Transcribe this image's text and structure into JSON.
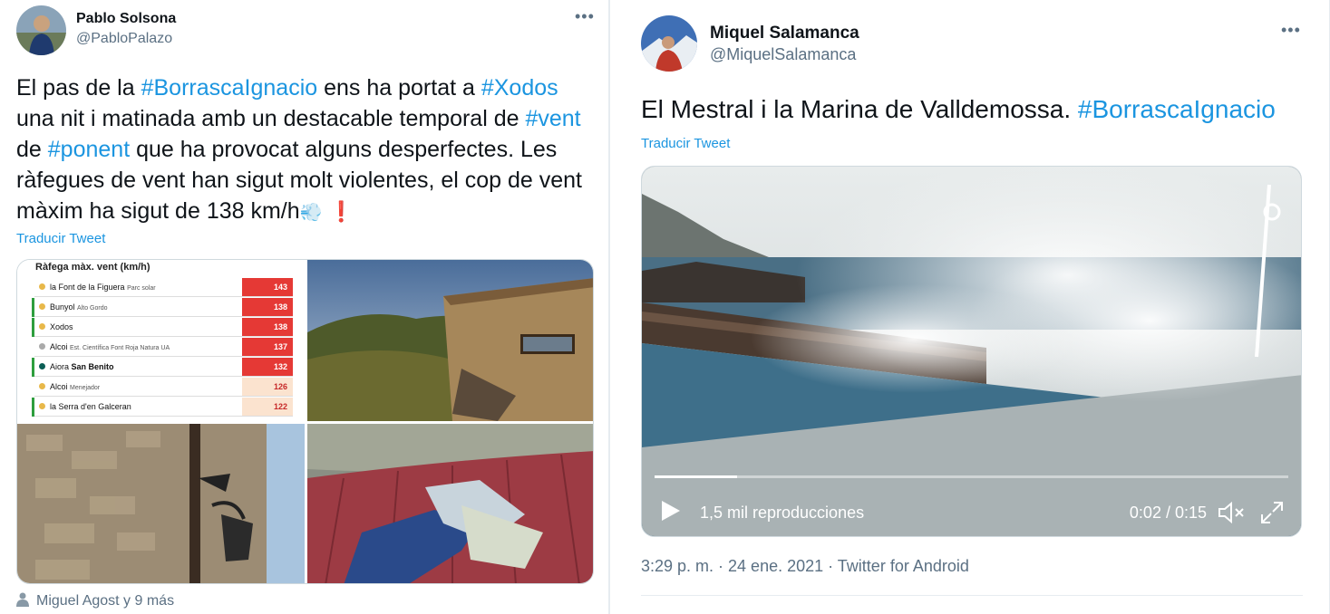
{
  "left_tweet": {
    "author_name": "Pablo Solsona",
    "handle": "@PabloPalazo",
    "more_label": "•••",
    "text_parts": {
      "p1": "El pas de la ",
      "h1": "#BorrascaIgnacio",
      "p2": " ens ha portat a ",
      "h2": "#Xodos",
      "p3": " una nit i matinada amb un destacable temporal de ",
      "h3": "#vent",
      "p4": " de ",
      "h4": "#ponent",
      "p5": " que ha provocat alguns desperfectes. Les ràfegues de vent han sigut molt violentes, el cop de vent màxim ha sigut de 138 km/h",
      "emoji_wind": "💨",
      "emoji_exclaim": "❗"
    },
    "translate_label": "Traducir Tweet",
    "wind_table": {
      "title": "Ràfega màx. vent (km/h)",
      "rows": [
        {
          "place": "la Font de la Figuera",
          "detail": "Parc solar",
          "value": "143",
          "dot": "#e8b84a",
          "bar": "#ffffff",
          "valcolor": "#e53935"
        },
        {
          "place": "Bunyol",
          "detail": "Alto Gordo",
          "value": "138",
          "dot": "#e8b84a",
          "bar": "#2e9e3e",
          "valcolor": "#e53935"
        },
        {
          "place": "Xodos",
          "detail": "",
          "value": "138",
          "dot": "#e8b84a",
          "bar": "#2e9e3e",
          "valcolor": "#e53935"
        },
        {
          "place": "Alcoi",
          "detail": "Est. Científica Font Roja Natura UA",
          "value": "137",
          "dot": "#aaaaaa",
          "bar": "#ffffff",
          "valcolor": "#e53935"
        },
        {
          "place": "Aiora",
          "detail": "San Benito",
          "value": "132",
          "dot": "#0b5e55",
          "bar": "#2e9e3e",
          "valcolor": "#e53935"
        },
        {
          "place": "Alcoi",
          "detail": "Menejador",
          "value": "126",
          "dot": "#e8b84a",
          "bar": "#ffffff",
          "valcolor": "#fbe3cf"
        },
        {
          "place": "la Serra d'en Galceran",
          "detail": "",
          "value": "122",
          "dot": "#e8b84a",
          "bar": "#2e9e3e",
          "valcolor": "#fbe3cf"
        }
      ]
    },
    "footer_text": "Miguel Agost y 9 más"
  },
  "right_tweet": {
    "author_name": "Miquel Salamanca",
    "handle": "@MiquelSalamanca",
    "more_label": "•••",
    "text_plain": "El Mestral i la Marina de Valldemossa. ",
    "hashtag": "#BorrascaIgnacio",
    "translate_label": "Traducir Tweet",
    "video": {
      "views": "1,5 mil reproducciones",
      "time": "0:02 / 0:15",
      "progress": 0.13
    },
    "meta": "3:29 p. m. · 24 ene. 2021 · Twitter for Android"
  },
  "colors": {
    "link": "#1b95e0",
    "secondary": "#5b7083",
    "text": "#0f1419"
  }
}
